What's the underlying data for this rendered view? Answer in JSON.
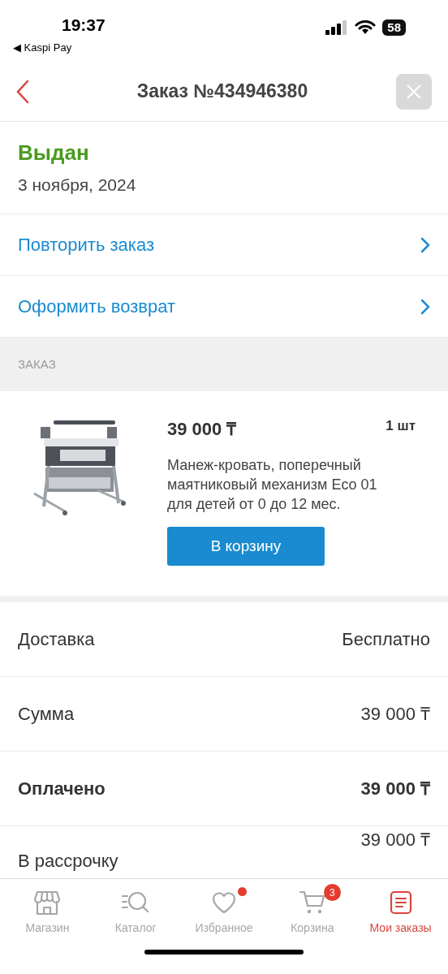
{
  "status_bar": {
    "time": "19:37",
    "back_app": "◀ Kaspi Pay",
    "battery": "58"
  },
  "header": {
    "title": "Заказ №434946380"
  },
  "order_status": {
    "status": "Выдан",
    "date": "3 ноября, 2024"
  },
  "actions": [
    {
      "label": "Повторить заказ"
    },
    {
      "label": "Оформить возврат"
    }
  ],
  "section_title": "ЗАКАЗ",
  "product": {
    "price": "39 000 ₸",
    "quantity": "1 шт",
    "name": "Манеж-кровать, поперечный маятниковый механизм Eco 01 для детей от 0 до 12 мес.",
    "button": "В корзину"
  },
  "summary": [
    {
      "label": "Доставка",
      "value": "Бесплатно",
      "bold": false
    },
    {
      "label": "Сумма",
      "value": "39 000 ₸",
      "bold": false
    },
    {
      "label": "Оплачено",
      "value": "39 000 ₸",
      "bold": true
    },
    {
      "label": "В рассрочку",
      "value": "39 000 ₸",
      "bold": false
    }
  ],
  "tab_bar": [
    {
      "kind": "store",
      "label": "Магазин",
      "selected": false
    },
    {
      "kind": "catalog",
      "label": "Каталог",
      "selected": false
    },
    {
      "kind": "favorites",
      "label": "Избранное",
      "selected": false,
      "dot": true
    },
    {
      "kind": "cart",
      "label": "Корзина",
      "selected": false,
      "badge": "3"
    },
    {
      "kind": "orders",
      "label": "Мои заказы",
      "selected": true
    }
  ]
}
